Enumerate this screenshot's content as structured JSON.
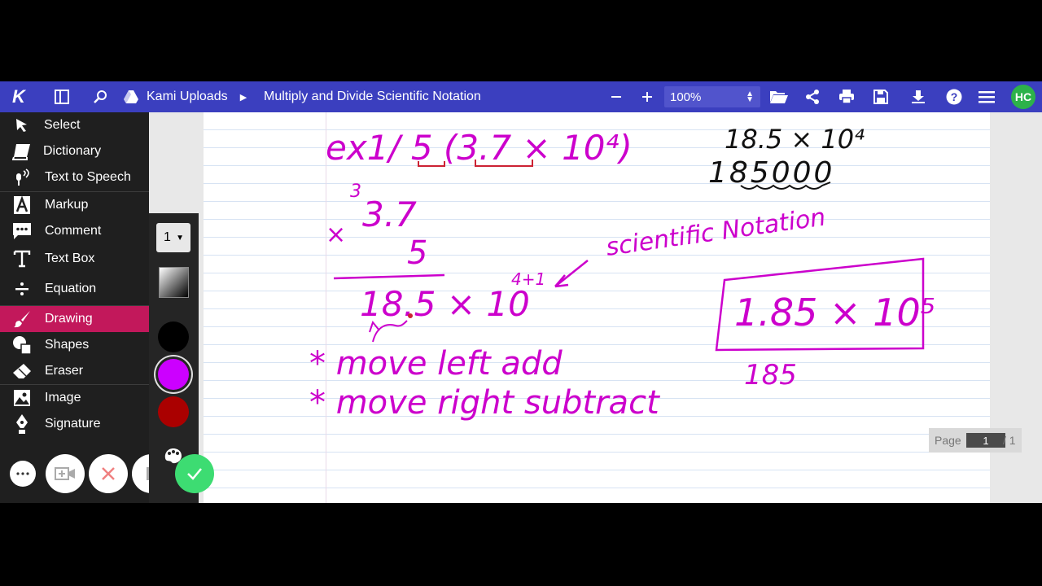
{
  "app": {
    "logo": "K",
    "breadcrumb_root": "Kami Uploads",
    "document_title": "Multiply and Divide Scientific Notation",
    "zoom": "100%",
    "user_initials": "HC"
  },
  "sidebar": {
    "items": [
      {
        "label": "Select"
      },
      {
        "label": "Dictionary"
      },
      {
        "label": "Text to Speech"
      },
      {
        "label": "Markup"
      },
      {
        "label": "Comment"
      },
      {
        "label": "Text Box"
      },
      {
        "label": "Equation"
      },
      {
        "label": "Drawing"
      },
      {
        "label": "Shapes"
      },
      {
        "label": "Eraser"
      },
      {
        "label": "Image"
      },
      {
        "label": "Signature"
      }
    ],
    "active": "Drawing"
  },
  "drawing_panel": {
    "stroke_width": "1",
    "colors": [
      "#000000",
      "#cc00ff",
      "#aa0000"
    ],
    "selected_color": "#cc00ff"
  },
  "pager": {
    "label": "Page",
    "current": "1",
    "total": "/ 1"
  },
  "handwriting": {
    "line1": "ex1/ 5 (3.7 × 10⁴)",
    "mult_top_carry": "3",
    "mult_top": "3.7",
    "mult_sign": "×",
    "mult_bottom": "5",
    "product": "18.5 × 10",
    "exponent": "4+1",
    "note_label": "scientific Notation",
    "right_top": "18.5 × 10⁴",
    "right_expanded": "185000",
    "boxed_answer": "1.85 × 10⁵",
    "rule1": "* move left add",
    "rule2": "* move right subtract",
    "digits": "185"
  },
  "colors": {
    "accent_bar": "#3b3fbf",
    "active_tool": "#c2185b",
    "ink_magenta": "#cc00cc",
    "ink_red": "#cc2233",
    "ink_black": "#111111"
  }
}
